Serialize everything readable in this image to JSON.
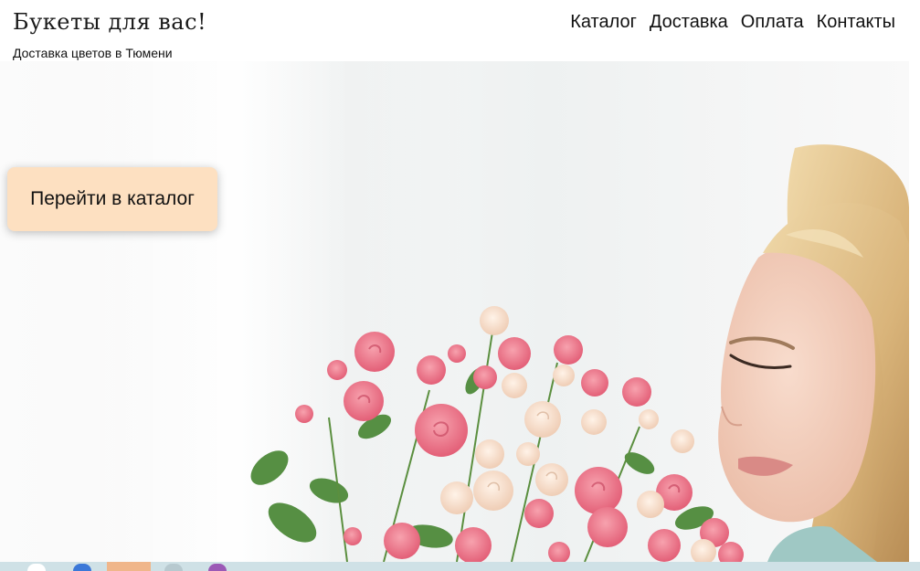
{
  "header": {
    "title": "Букеты для вас!",
    "subtitle": "Доставка цветов в Тюмени"
  },
  "nav": {
    "items": [
      {
        "label": "Каталог"
      },
      {
        "label": "Доставка"
      },
      {
        "label": "Оплата"
      },
      {
        "label": "Контакты"
      }
    ]
  },
  "hero": {
    "cta_label": "Перейти в каталог",
    "cta_color": "#fde0c1"
  },
  "colors": {
    "rose": "#f2768a",
    "cream_rose": "#f6dcc8",
    "leaf": "#4e8a3a",
    "hair": "#e3c48e",
    "skin": "#f6d6c6",
    "taskbar": "#cfe1e6"
  }
}
